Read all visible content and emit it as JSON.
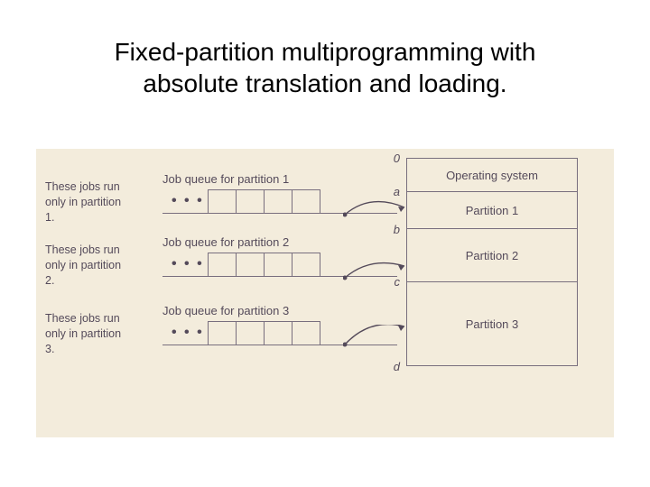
{
  "title_line1": "Fixed-partition multiprogramming with",
  "title_line2": "absolute translation and loading.",
  "memory": {
    "os": "Operating system",
    "p1": "Partition 1",
    "p2": "Partition 2",
    "p3": "Partition 3"
  },
  "addr": {
    "zero": "0",
    "a": "a",
    "b": "b",
    "c": "c",
    "d": "d"
  },
  "notes": {
    "n1": "These jobs run only in partition 1.",
    "n2": "These jobs run only in partition 2.",
    "n3": "These jobs run only in partition 3."
  },
  "queues": {
    "q1": "Job queue for partition 1",
    "q2": "Job queue for partition 2",
    "q3": "Job queue for partition 3",
    "dots": "• • •"
  }
}
